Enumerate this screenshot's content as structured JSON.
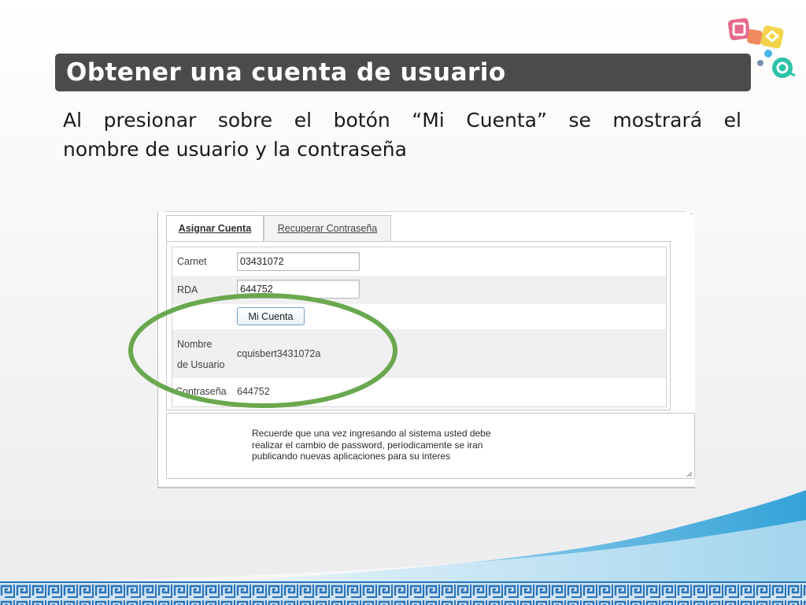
{
  "slide": {
    "title": "Obtener una cuenta de usuario",
    "body_line1": "Al presionar sobre el botón “Mi Cuenta” se mostrará el",
    "body_line2": "nombre de usuario y la contraseña"
  },
  "app": {
    "tabs": [
      {
        "label": "Asignar Cuenta",
        "active": true
      },
      {
        "label": "Recuperar Contraseña",
        "active": false
      }
    ],
    "form": {
      "carnet_label": "Carnet",
      "carnet_value": "03431072",
      "rda_label": "RDA",
      "rda_value": "644752",
      "button_label": "Mi Cuenta",
      "nombre_label_line1": "Nombre",
      "nombre_label_line2": "de Usuario",
      "nombre_value": "cquisbert3431072a",
      "contrasena_label": "Contraseña",
      "contrasena_value": "644752"
    },
    "notes": {
      "line1": "Recuerde que una vez ingresando al sistema usted debe",
      "line2": "realizar el cambio de password, periodicamente se iran",
      "line3": "publicando nuevas aplicaciones para su interes"
    }
  },
  "colors": {
    "title_bar": "#4b4b4b",
    "highlight_ellipse": "#6aa84f",
    "wave_blue": "#1f9ad6",
    "border_pattern": "#2a73b8"
  },
  "icons": [
    "logo-icon",
    "resize-grip-icon"
  ]
}
